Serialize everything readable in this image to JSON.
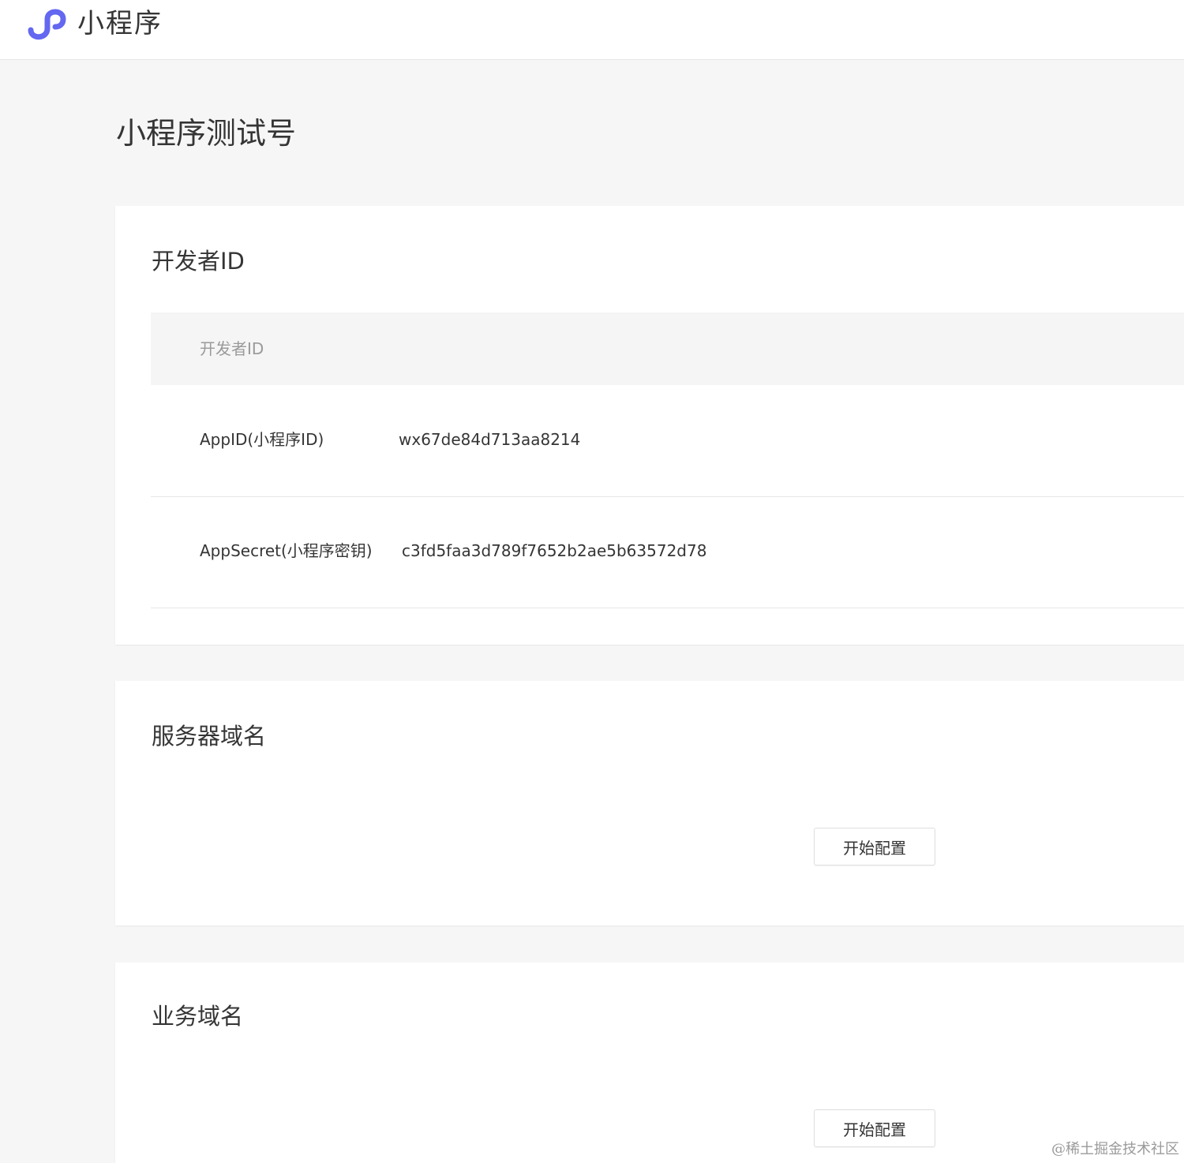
{
  "header": {
    "logo_icon": "mini-program-logo-icon",
    "brand_text": "小程序",
    "brand_color": "#6467f0"
  },
  "page": {
    "title": "小程序测试号"
  },
  "developer_id": {
    "section_title": "开发者ID",
    "table_header": "开发者ID",
    "rows": [
      {
        "label": "AppID(小程序ID)",
        "value": "wx67de84d713aa8214"
      },
      {
        "label": "AppSecret(小程序密钥)",
        "value": "c3fd5faa3d789f7652b2ae5b63572d78"
      }
    ]
  },
  "server_domain": {
    "section_title": "服务器域名",
    "button_label": "开始配置"
  },
  "business_domain": {
    "section_title": "业务域名",
    "button_label": "开始配置"
  },
  "watermark": "@稀土掘金技术社区"
}
